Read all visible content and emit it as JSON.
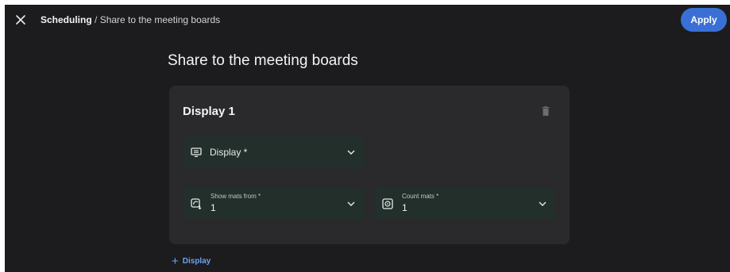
{
  "topbar": {
    "breadcrumb_root": "Scheduling",
    "breadcrumb_separator": " / ",
    "breadcrumb_current": "Share to the meeting boards",
    "apply_label": "Apply",
    "close_icon": "close-icon"
  },
  "page": {
    "title": "Share to the meeting boards"
  },
  "display_card": {
    "title": "Display 1",
    "delete_icon": "trash-icon",
    "display_select": {
      "label": "Display *",
      "icon": "display-icon"
    },
    "show_mats_from": {
      "label": "Show mats from *",
      "value": "1",
      "icon": "mat-source-icon"
    },
    "count_mats": {
      "label": "Count mats *",
      "value": "1",
      "icon": "counter-icon"
    }
  },
  "add_display": {
    "label": "Display",
    "icon": "plus-icon"
  },
  "colors": {
    "background": "#1c1c1e",
    "card": "#2a2a2d",
    "field": "#222f2b",
    "accent": "#3a6fd6",
    "link": "#6ea1f5"
  }
}
